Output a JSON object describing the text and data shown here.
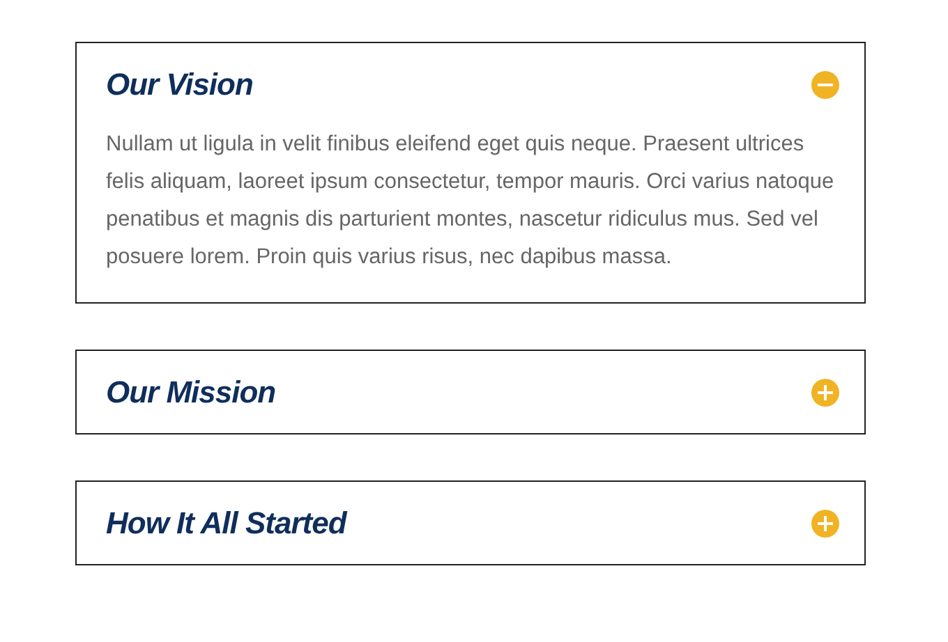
{
  "accordion": [
    {
      "title": "Our Vision",
      "expanded": true,
      "body": "Nullam ut ligula in velit finibus eleifend eget quis neque. Praesent ultrices felis aliquam, laoreet ipsum consectetur, tempor mauris. Orci varius natoque penatibus et magnis dis parturient montes, nascetur ridiculus mus. Sed vel posuere lorem. Proin quis varius risus, nec dapibus massa."
    },
    {
      "title": "Our Mission",
      "expanded": false
    },
    {
      "title": "How It All Started",
      "expanded": false
    }
  ]
}
